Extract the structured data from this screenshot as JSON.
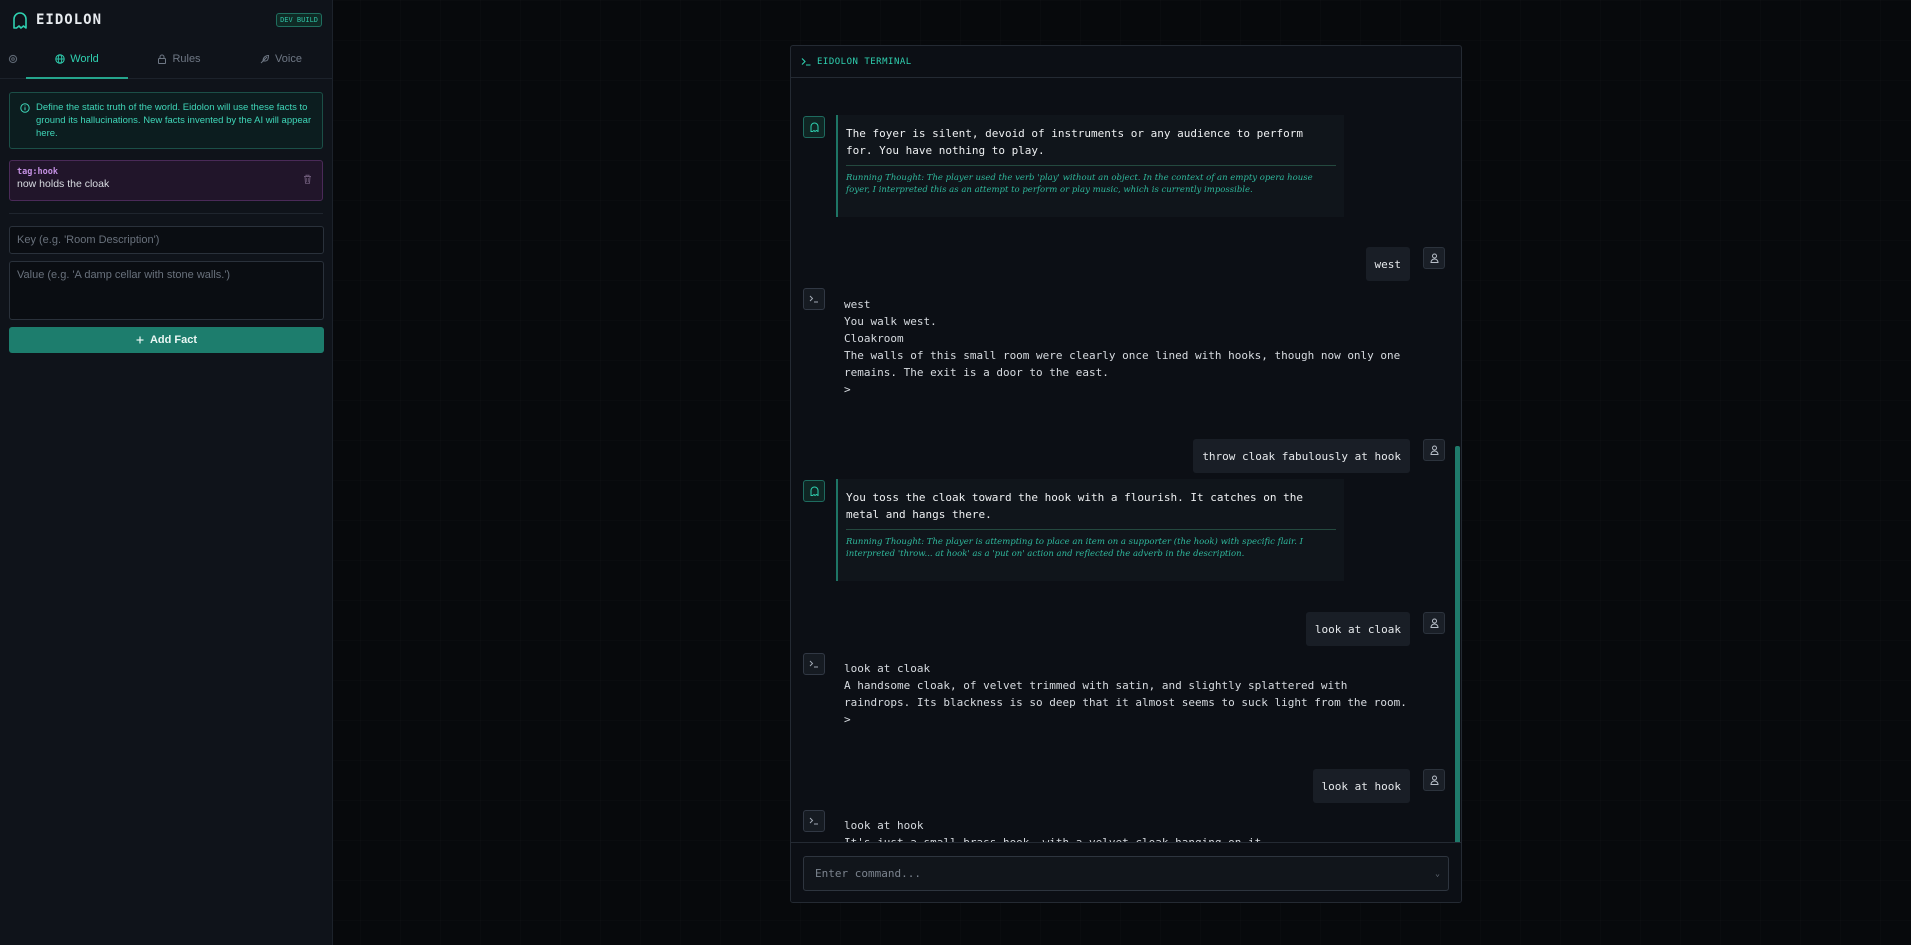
{
  "sidebar": {
    "brand": "EIDOLON",
    "badge": "DEV BUILD",
    "tabs": [
      "World",
      "Rules",
      "Voice"
    ],
    "info": "Define the static truth of the world. Eidolon will use these facts to ground its hallucinations. New facts invented by the AI will appear here.",
    "facts": [
      {
        "key": "tag:hook",
        "value": "now holds the cloak"
      }
    ],
    "key_placeholder": "Key (e.g. 'Room Description')",
    "value_placeholder": "Value (e.g. 'A damp cellar with stone walls.')",
    "add_label": "Add Fact"
  },
  "terminal": {
    "title": "EIDOLON TERMINAL",
    "messages": [
      {
        "role": "ai",
        "text": "The foyer is silent, devoid of instruments or any audience to perform for. You have nothing to play.",
        "thought": "Running Thought: The player used the verb 'play' without an object. In the context of an empty opera house foyer, I interpreted this as an attempt to perform or play music, which is currently impossible."
      },
      {
        "role": "user",
        "text": "west"
      },
      {
        "role": "system",
        "text": "west\nYou walk west.\nCloakroom\nThe walls of this small room were clearly once lined with hooks, though now only one\nremains. The exit is a door to the east.\n>"
      },
      {
        "role": "user",
        "text": "throw cloak fabulously at hook"
      },
      {
        "role": "ai",
        "text": "You toss the cloak toward the hook with a flourish. It catches on the metal and hangs there.",
        "thought": "Running Thought: The player is attempting to place an item on a supporter (the hook) with specific flair. I interpreted 'throw... at hook' as a 'put on' action and reflected the adverb in the description."
      },
      {
        "role": "user",
        "text": "look at cloak"
      },
      {
        "role": "system",
        "text": "look at cloak\nA handsome cloak, of velvet trimmed with satin, and slightly splattered with\nraindrops. Its blackness is so deep that it almost seems to suck light from the room.\n>"
      },
      {
        "role": "user",
        "text": "look at hook"
      },
      {
        "role": "system",
        "text": "look at hook\nIt's just a small brass hook, with a velvet cloak hanging on it.\nA velvet cloak is on the small brass hook."
      }
    ],
    "input_placeholder": "Enter command..."
  },
  "colors": {
    "accent": "#2fd0b0",
    "button": "#1d7d6d",
    "fact_border": "#4a2a58"
  }
}
